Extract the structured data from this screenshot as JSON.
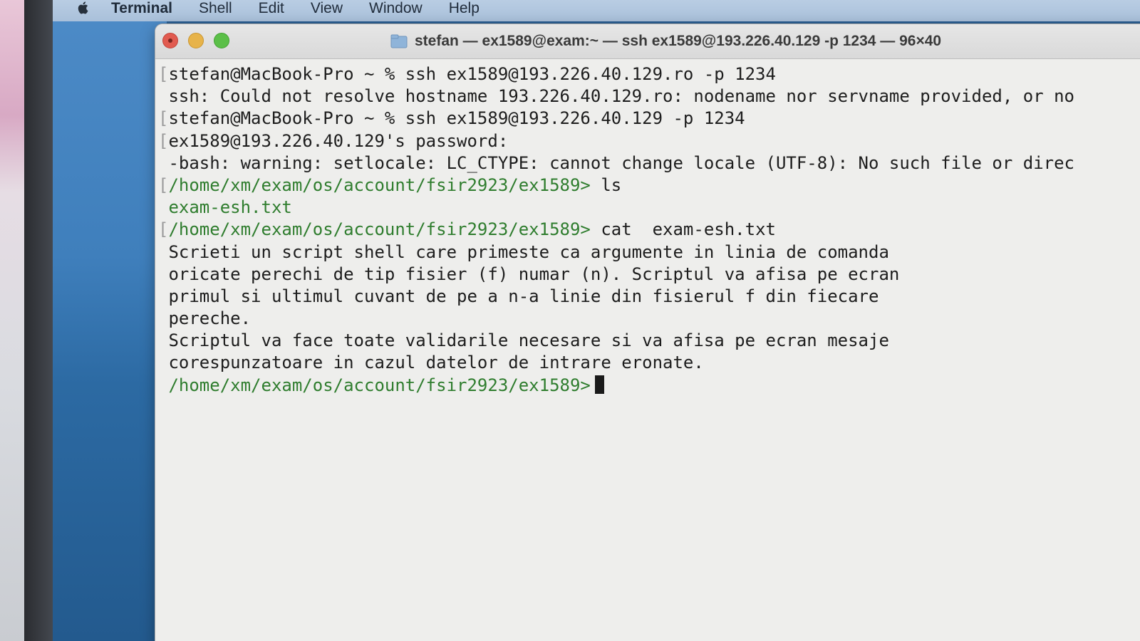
{
  "menubar": {
    "app_name": "Terminal",
    "items": [
      "Shell",
      "Edit",
      "View",
      "Window",
      "Help"
    ]
  },
  "window": {
    "title": "stefan — ex1589@exam:~ — ssh ex1589@193.226.40.129 -p 1234 — 96×40"
  },
  "terminal": {
    "lines": [
      {
        "mark": "[",
        "prompt": "",
        "text": "stefan@MacBook-Pro ~ % ssh ex1589@193.226.40.129.ro -p 1234"
      },
      {
        "mark": "",
        "prompt": "",
        "text": "ssh: Could not resolve hostname 193.226.40.129.ro: nodename nor servname provided, or no"
      },
      {
        "mark": "[",
        "prompt": "",
        "text": "stefan@MacBook-Pro ~ % ssh ex1589@193.226.40.129 -p 1234"
      },
      {
        "mark": "[",
        "prompt": "",
        "text": "ex1589@193.226.40.129's password:"
      },
      {
        "mark": "",
        "prompt": "",
        "text": "-bash: warning: setlocale: LC_CTYPE: cannot change locale (UTF-8): No such file or direc"
      },
      {
        "mark": "[",
        "prompt": "/home/xm/exam/os/account/fsir2923/ex1589>",
        "text": " ls"
      },
      {
        "mark": "",
        "prompt": "exam-esh.txt",
        "text": ""
      },
      {
        "mark": "[",
        "prompt": "/home/xm/exam/os/account/fsir2923/ex1589>",
        "text": " cat  exam-esh.txt"
      },
      {
        "mark": "",
        "prompt": "",
        "text": "Scrieti un script shell care primeste ca argumente in linia de comanda"
      },
      {
        "mark": "",
        "prompt": "",
        "text": "oricate perechi de tip fisier (f) numar (n). Scriptul va afisa pe ecran"
      },
      {
        "mark": "",
        "prompt": "",
        "text": "primul si ultimul cuvant de pe a n-a linie din fisierul f din fiecare"
      },
      {
        "mark": "",
        "prompt": "",
        "text": "pereche."
      },
      {
        "mark": "",
        "prompt": "",
        "text": "Scriptul va face toate validarile necesare si va afisa pe ecran mesaje"
      },
      {
        "mark": "",
        "prompt": "",
        "text": "corespunzatoare in cazul datelor de intrare eronate."
      }
    ],
    "current_prompt": "/home/xm/exam/os/account/fsir2923/ex1589>"
  },
  "colors": {
    "prompt": "#2f7d2e",
    "text": "#1d1d1d",
    "background": "#eeeeec"
  },
  "icons": {
    "apple": "apple-icon",
    "folder": "folder-icon"
  }
}
